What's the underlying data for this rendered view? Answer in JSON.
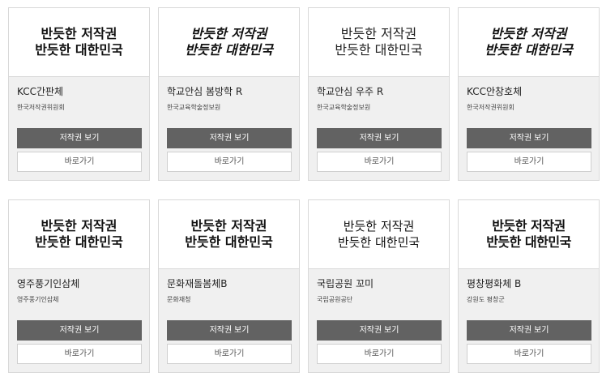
{
  "cards": [
    {
      "preview_line1": "반듯한 저작권",
      "preview_line2": "반듯한 대한민국",
      "name": "KCC간판체",
      "publisher": "한국저작권위원회",
      "copyright_label": "저작권 보기",
      "go_label": "바로가기"
    },
    {
      "preview_line1": "반듯한 저작권",
      "preview_line2": "반듯한 대한민국",
      "name": "학교안심 봄방학 R",
      "publisher": "한국교육학술정보원",
      "copyright_label": "저작권 보기",
      "go_label": "바로가기"
    },
    {
      "preview_line1": "반듯한 저작권",
      "preview_line2": "반듯한 대한민국",
      "name": "학교안심 우주 R",
      "publisher": "한국교육학술정보원",
      "copyright_label": "저작권 보기",
      "go_label": "바로가기"
    },
    {
      "preview_line1": "반듯한 저작권",
      "preview_line2": "반듯한 대한민국",
      "name": "KCC안창호체",
      "publisher": "한국저작권위원회",
      "copyright_label": "저작권 보기",
      "go_label": "바로가기"
    },
    {
      "preview_line1": "반듯한 저작권",
      "preview_line2": "반듯한 대한민국",
      "name": "영주풍기인삼체",
      "publisher": "영주풍기인삼체",
      "copyright_label": "저작권 보기",
      "go_label": "바로가기"
    },
    {
      "preview_line1": "반듯한 저작권",
      "preview_line2": "반듯한 대한민국",
      "name": "문화재돌봄체B",
      "publisher": "문화재청",
      "copyright_label": "저작권 보기",
      "go_label": "바로가기"
    },
    {
      "preview_line1": "반듯한 저작권",
      "preview_line2": "반듯한 대한민국",
      "name": "국립공원 꼬미",
      "publisher": "국립공원공단",
      "copyright_label": "저작권 보기",
      "go_label": "바로가기"
    },
    {
      "preview_line1": "반듯한 저작권",
      "preview_line2": "반듯한 대한민국",
      "name": "평창평화체 B",
      "publisher": "강원도 평창군",
      "copyright_label": "저작권 보기",
      "go_label": "바로가기"
    }
  ],
  "colors": {
    "primary_button": "#626262",
    "card_background": "#f0f0f0",
    "border": "#d9d9d9"
  }
}
